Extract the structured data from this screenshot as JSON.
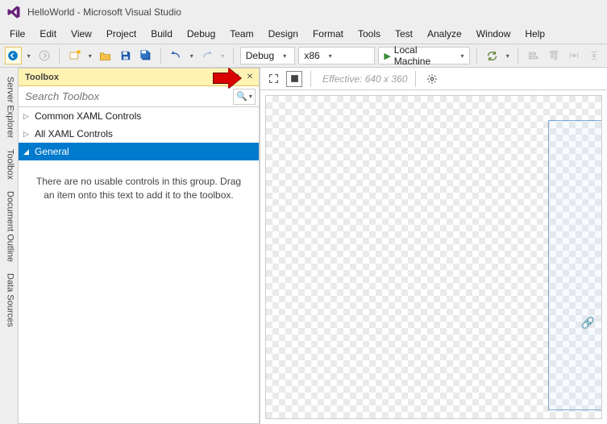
{
  "window": {
    "title": "HelloWorld - Microsoft Visual Studio"
  },
  "menu": {
    "items": [
      "File",
      "Edit",
      "View",
      "Project",
      "Build",
      "Debug",
      "Team",
      "Design",
      "Format",
      "Tools",
      "Test",
      "Analyze",
      "Window",
      "Help"
    ]
  },
  "toolbar": {
    "config_label": "Debug",
    "platform_label": "x86",
    "run_label": "Local Machine"
  },
  "side_tabs": [
    "Server Explorer",
    "Toolbox",
    "Document Outline",
    "Data Sources"
  ],
  "toolbox": {
    "title": "Toolbox",
    "search_placeholder": "Search Toolbox",
    "groups": {
      "common": "Common XAML Controls",
      "all": "All XAML Controls",
      "general": "General"
    },
    "empty_msg": "There are no usable controls in this group. Drag an item onto this text to add it to the toolbox."
  },
  "designer": {
    "effective_label": "Effective: 640 x 360"
  }
}
